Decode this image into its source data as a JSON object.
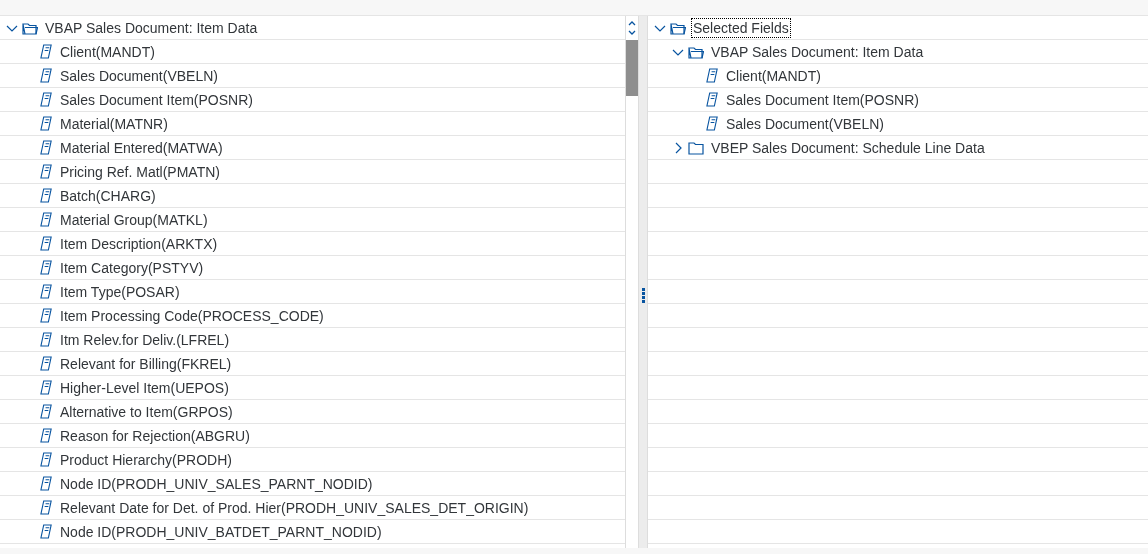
{
  "left_tree": {
    "nodes": [
      {
        "label": "VBAP Sales Document: Item Data",
        "kind": "folder",
        "expanded": true,
        "selected": false,
        "children": [
          {
            "label": "Client(MANDT)",
            "kind": "field",
            "selected": false
          },
          {
            "label": "Sales Document(VBELN)",
            "kind": "field",
            "selected": false
          },
          {
            "label": "Sales Document Item(POSNR)",
            "kind": "field",
            "selected": false
          },
          {
            "label": "Material(MATNR)",
            "kind": "field",
            "selected": false
          },
          {
            "label": "Material Entered(MATWA)",
            "kind": "field",
            "selected": false
          },
          {
            "label": "Pricing Ref. Matl(PMATN)",
            "kind": "field",
            "selected": false
          },
          {
            "label": "Batch(CHARG)",
            "kind": "field",
            "selected": false
          },
          {
            "label": "Material Group(MATKL)",
            "kind": "field",
            "selected": false
          },
          {
            "label": "Item Description(ARKTX)",
            "kind": "field",
            "selected": false
          },
          {
            "label": "Item Category(PSTYV)",
            "kind": "field",
            "selected": false
          },
          {
            "label": "Item Type(POSAR)",
            "kind": "field",
            "selected": false
          },
          {
            "label": "Item Processing Code(PROCESS_CODE)",
            "kind": "field",
            "selected": false
          },
          {
            "label": "Itm Relev.for Deliv.(LFREL)",
            "kind": "field",
            "selected": false
          },
          {
            "label": "Relevant for Billing(FKREL)",
            "kind": "field",
            "selected": false
          },
          {
            "label": "Higher-Level Item(UEPOS)",
            "kind": "field",
            "selected": false
          },
          {
            "label": "Alternative to Item(GRPOS)",
            "kind": "field",
            "selected": false
          },
          {
            "label": "Reason for Rejection(ABGRU)",
            "kind": "field",
            "selected": false
          },
          {
            "label": "Product Hierarchy(PRODH)",
            "kind": "field",
            "selected": false
          },
          {
            "label": "Node ID(PRODH_UNIV_SALES_PARNT_NODID)",
            "kind": "field",
            "selected": false
          },
          {
            "label": "Relevant Date for Det. of Prod. Hier(PRODH_UNIV_SALES_DET_ORIGIN)",
            "kind": "field",
            "selected": false
          },
          {
            "label": "Node ID(PRODH_UNIV_BATDET_PARNT_NODID)",
            "kind": "field",
            "selected": false
          }
        ]
      }
    ]
  },
  "right_tree": {
    "nodes": [
      {
        "label": "Selected Fields",
        "kind": "folder",
        "expanded": true,
        "selected": true,
        "children": [
          {
            "label": "VBAP Sales Document: Item Data",
            "kind": "folder",
            "expanded": true,
            "selected": false,
            "children": [
              {
                "label": "Client(MANDT)",
                "kind": "field",
                "selected": false
              },
              {
                "label": "Sales Document Item(POSNR)",
                "kind": "field",
                "selected": false
              },
              {
                "label": "Sales Document(VBELN)",
                "kind": "field",
                "selected": false
              }
            ]
          },
          {
            "label": "VBEP Sales Document: Schedule Line Data",
            "kind": "folder",
            "expanded": false,
            "selected": false
          }
        ]
      }
    ]
  }
}
